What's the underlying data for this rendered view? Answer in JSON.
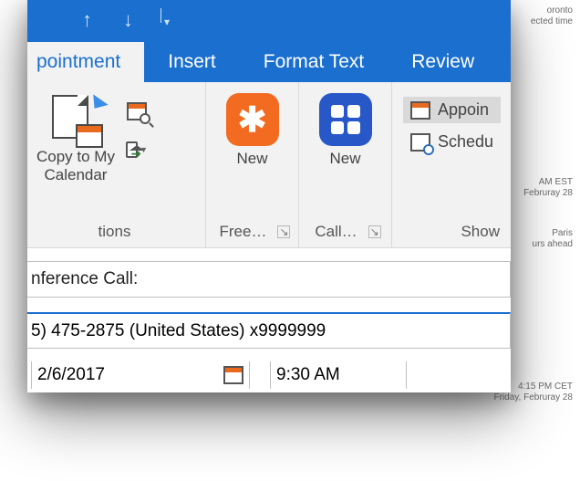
{
  "tabs": {
    "appointment": "pointment",
    "insert": "Insert",
    "format_text": "Format Text",
    "review": "Review"
  },
  "ribbon": {
    "copy_to_calendar": "Copy to My\nCalendar",
    "actions_label": "tions",
    "free_new": "New",
    "free_label": "Free…",
    "call_new": "New",
    "call_label": "Call…",
    "show_appointment": "Appoin",
    "show_scheduling": "Schedu",
    "show_label": "Show"
  },
  "form": {
    "subject_label": "nference Call:",
    "location_value": "5) 475-2875 (United States) x9999999",
    "start_date": "2/6/2017",
    "start_time": "9:30 AM"
  },
  "overlays": {
    "o1a": "oronto",
    "o1b": "ected time",
    "o2a": "AM EST",
    "o2b": "Februray 28",
    "o3a": "Paris",
    "o3b": "urs ahead",
    "o4a": "4:15 PM CET",
    "o4b": "Friday, Februray 28"
  }
}
